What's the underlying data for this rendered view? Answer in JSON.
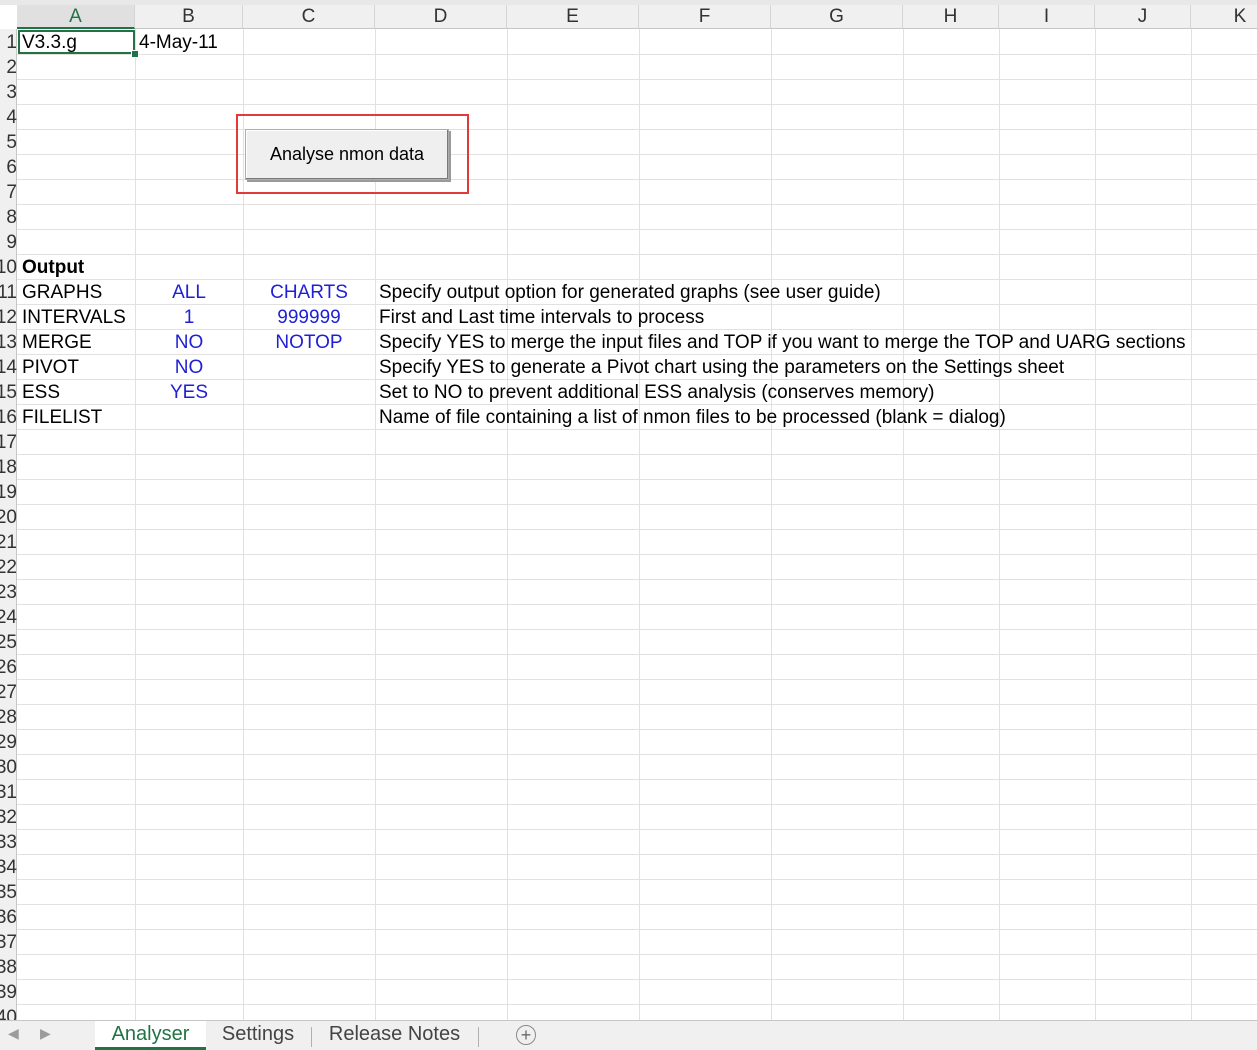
{
  "columns": [
    "A",
    "B",
    "C",
    "D",
    "E",
    "F",
    "G",
    "H",
    "I",
    "J",
    "K"
  ],
  "selected_column": "A",
  "row_numbers": [
    "1",
    "2",
    "3",
    "4",
    "5",
    "6",
    "7",
    "8",
    "9",
    "10",
    "11",
    "12",
    "13",
    "14",
    "15",
    "16",
    "17",
    "18",
    "19",
    "20",
    "21",
    "22",
    "23",
    "24",
    "25",
    "26",
    "27",
    "28",
    "29",
    "30",
    "31",
    "32",
    "33",
    "34",
    "35",
    "36",
    "37",
    "38",
    "39",
    "40"
  ],
  "cells": {
    "a1": "V3.3.g",
    "b1": "4-May-11",
    "a10": "Output",
    "rows": [
      {
        "a": "GRAPHS",
        "b": "ALL",
        "c": "CHARTS",
        "d": "Specify output option for generated graphs (see user guide)"
      },
      {
        "a": "INTERVALS",
        "b": "1",
        "c": "999999",
        "d": "First and Last time intervals to process"
      },
      {
        "a": "MERGE",
        "b": "NO",
        "c": "NOTOP",
        "d": "Specify YES to merge the input files and TOP if you want to merge the TOP and UARG sections"
      },
      {
        "a": "PIVOT",
        "b": "NO",
        "c": "",
        "d": "Specify YES to generate a Pivot chart using the parameters on the Settings sheet"
      },
      {
        "a": "ESS",
        "b": "YES",
        "c": "",
        "d": "Set to NO to prevent additional ESS analysis (conserves memory)"
      },
      {
        "a": "FILELIST",
        "b": "",
        "c": "",
        "d": "Name of file containing a list of nmon files to be processed (blank = dialog)"
      }
    ]
  },
  "button": {
    "label": "Analyse nmon data"
  },
  "tabs": [
    {
      "label": "Analyser",
      "active": true
    },
    {
      "label": "Settings",
      "active": false
    },
    {
      "label": "Release Notes",
      "active": false
    }
  ],
  "add_sheet_icon": "plus-circle-icon",
  "colors": {
    "accent": "#217346",
    "value_blue": "#1f1fd6",
    "highlight_red": "#e23a3a"
  }
}
